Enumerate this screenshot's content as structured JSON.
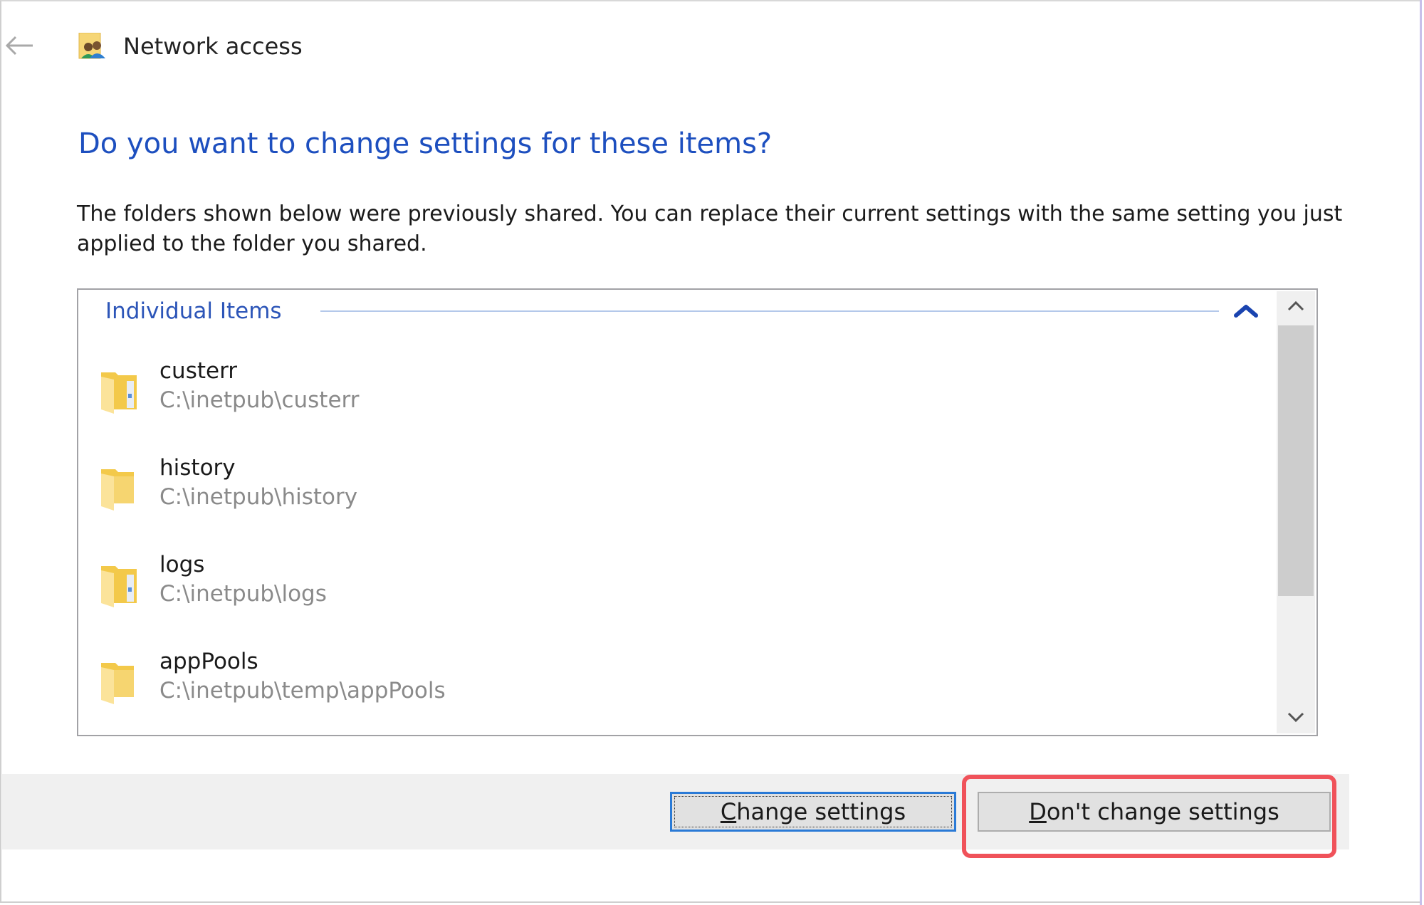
{
  "window": {
    "title": "Network access",
    "back_icon": "back-arrow-icon",
    "title_icon": "network-users-folder-icon"
  },
  "dialog": {
    "heading": "Do you want to change settings for these items?",
    "description": "The folders shown below were previously shared. You can replace their current settings with the same setting you just applied to the folder you shared."
  },
  "list": {
    "group_label": "Individual Items",
    "collapse_icon": "chevron-up-icon",
    "items": [
      {
        "name": "custerr",
        "path": "C:\\inetpub\\custerr",
        "icon": "folder-icon"
      },
      {
        "name": "history",
        "path": "C:\\inetpub\\history",
        "icon": "folder-icon"
      },
      {
        "name": "logs",
        "path": "C:\\inetpub\\logs",
        "icon": "folder-icon"
      },
      {
        "name": "appPools",
        "path": "C:\\inetpub\\temp\\appPools",
        "icon": "folder-icon"
      }
    ],
    "scrollbar": {
      "thumb_fraction": 0.66,
      "position": 0
    }
  },
  "buttons": {
    "change": {
      "mnemonic": "C",
      "rest": "hange settings"
    },
    "dont_change": {
      "mnemonic": "D",
      "rest": "on't change settings"
    }
  },
  "colors": {
    "heading": "#1d4fbf",
    "focus_border": "#2a7ad6",
    "highlight": "#f0525a",
    "footer_bg": "#f0f0f0"
  }
}
